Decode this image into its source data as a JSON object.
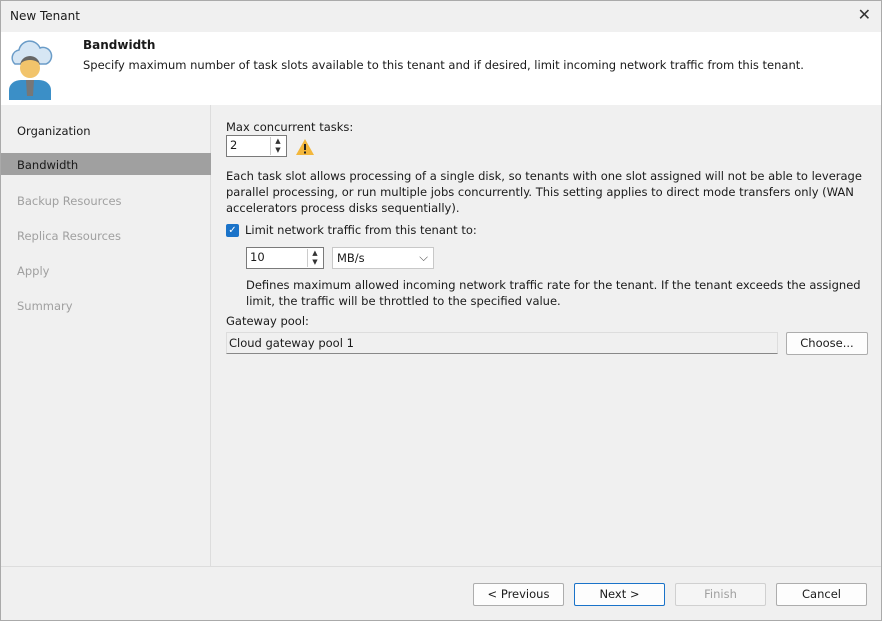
{
  "window": {
    "title": "New Tenant"
  },
  "header": {
    "title": "Bandwidth",
    "description": "Specify maximum number of task slots available to this tenant and if desired, limit incoming network traffic from this tenant."
  },
  "sidebar": {
    "items": [
      {
        "label": "Organization",
        "state": "normal"
      },
      {
        "label": "Bandwidth",
        "state": "active"
      },
      {
        "label": "Backup Resources",
        "state": "disabled"
      },
      {
        "label": "Replica Resources",
        "state": "disabled"
      },
      {
        "label": "Apply",
        "state": "disabled"
      },
      {
        "label": "Summary",
        "state": "disabled"
      }
    ]
  },
  "main": {
    "max_tasks_label": "Max concurrent tasks:",
    "max_tasks_value": "2",
    "task_note": "Each task slot allows processing of a single disk, so tenants with one slot assigned will not be able to leverage parallel processing, or run multiple jobs concurrently. This setting applies to direct mode transfers only (WAN accelerators process disks sequentially).",
    "limit_label": "Limit network traffic from this tenant to:",
    "limit_checked": true,
    "limit_value": "10",
    "limit_unit": "MB/s",
    "limit_note": "Defines maximum allowed incoming network traffic rate for the tenant.  If the tenant exceeds the assigned limit, the traffic will be throttled to the specified value.",
    "gateway_label": "Gateway pool:",
    "gateway_value": "Cloud gateway pool 1",
    "choose_label": "Choose..."
  },
  "footer": {
    "previous": "< Previous",
    "next": "Next >",
    "finish": "Finish",
    "cancel": "Cancel"
  }
}
